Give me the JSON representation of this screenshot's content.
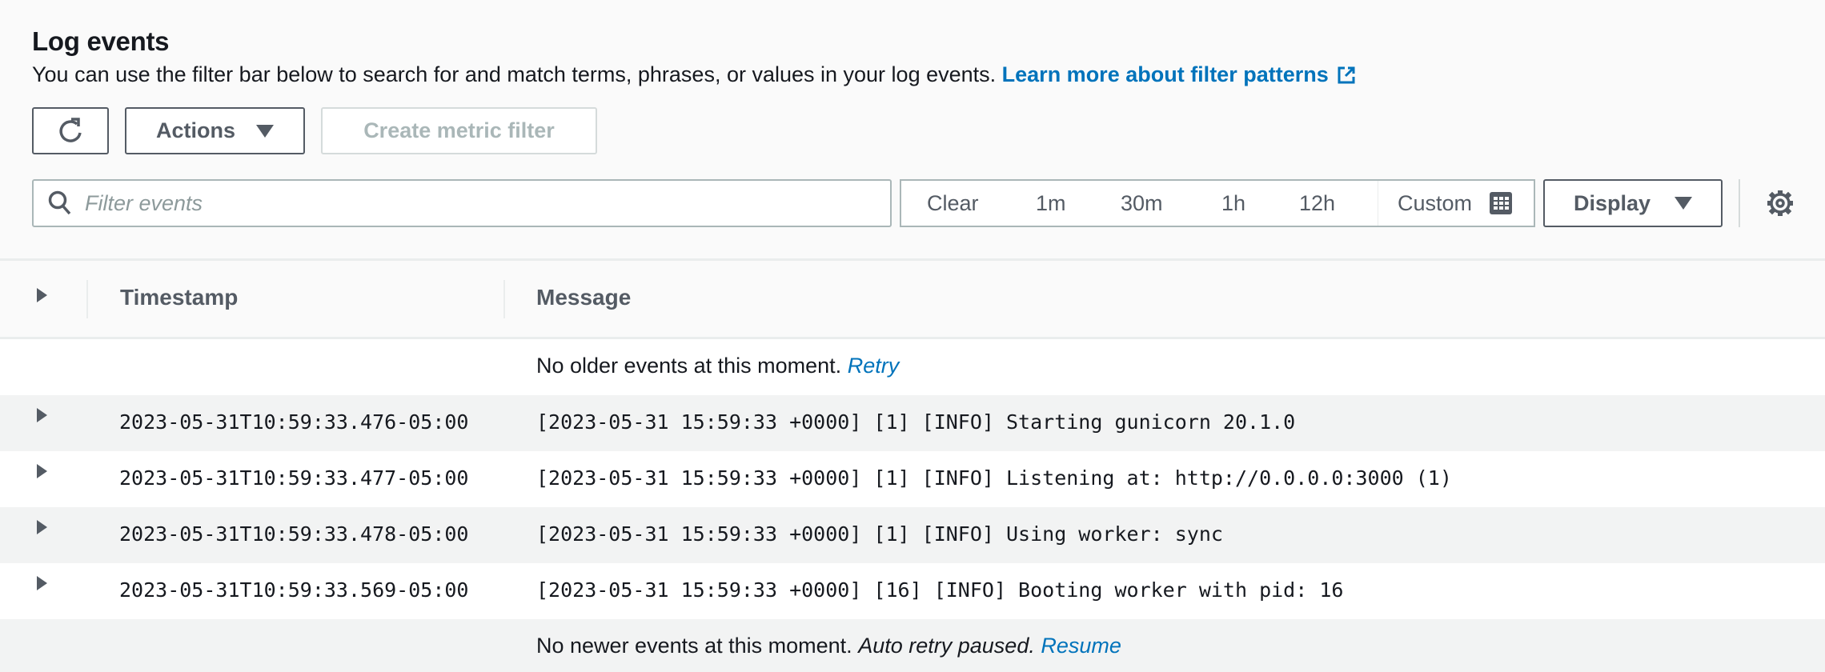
{
  "header": {
    "title": "Log events",
    "description": "You can use the filter bar below to search for and match terms, phrases, or values in your log events.",
    "learn_more_link": "Learn more about filter patterns"
  },
  "toolbar": {
    "refresh_icon": "refresh-icon",
    "actions_label": "Actions",
    "create_metric_filter_label": "Create metric filter"
  },
  "filter": {
    "placeholder": "Filter events",
    "value": ""
  },
  "time_range": {
    "options": [
      "Clear",
      "1m",
      "30m",
      "1h",
      "12h"
    ],
    "custom_label": "Custom"
  },
  "display_label": "Display",
  "colors": {
    "link": "#0073bb",
    "text": "#16191f",
    "secondary": "#545b64",
    "row_alt": "#f2f3f3"
  },
  "table": {
    "columns": [
      "Timestamp",
      "Message"
    ],
    "older_note": "No older events at this moment.",
    "older_retry": "Retry",
    "events": [
      {
        "timestamp": "2023-05-31T10:59:33.476-05:00",
        "message": "[2023-05-31 15:59:33 +0000] [1] [INFO] Starting gunicorn 20.1.0"
      },
      {
        "timestamp": "2023-05-31T10:59:33.477-05:00",
        "message": "[2023-05-31 15:59:33 +0000] [1] [INFO] Listening at: http://0.0.0.0:3000 (1)"
      },
      {
        "timestamp": "2023-05-31T10:59:33.478-05:00",
        "message": "[2023-05-31 15:59:33 +0000] [1] [INFO] Using worker: sync"
      },
      {
        "timestamp": "2023-05-31T10:59:33.569-05:00",
        "message": "[2023-05-31 15:59:33 +0000] [16] [INFO] Booting worker with pid: 16"
      }
    ],
    "newer_note": "No newer events at this moment.",
    "newer_paused": "Auto retry paused.",
    "newer_resume": "Resume"
  }
}
